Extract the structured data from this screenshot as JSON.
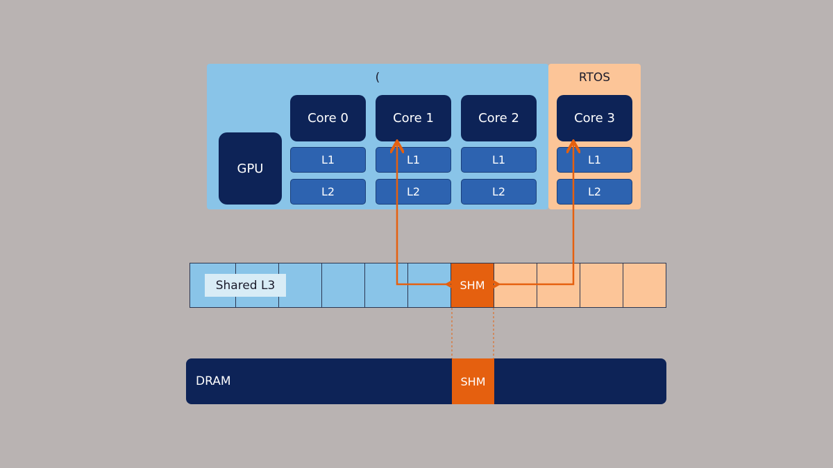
{
  "regions": {
    "general_title": "(",
    "rtos_title": "RTOS"
  },
  "gpu": "GPU",
  "cores": [
    {
      "name": "Core 0",
      "l1": "L1",
      "l2": "L2"
    },
    {
      "name": "Core 1",
      "l1": "L1",
      "l2": "L2"
    },
    {
      "name": "Core 2",
      "l1": "L1",
      "l2": "L2"
    },
    {
      "name": "Core 3",
      "l1": "L1",
      "l2": "L2"
    }
  ],
  "l3": {
    "label": "Shared L3",
    "shm": "SHM"
  },
  "dram": {
    "label": "DRAM",
    "shm": "SHM"
  },
  "colors": {
    "general": "#89c4e8",
    "rtos": "#fcc598",
    "core": "#0d2357",
    "cache": "#2d63b0",
    "shm": "#e5600f",
    "background": "#b9b3b2"
  }
}
